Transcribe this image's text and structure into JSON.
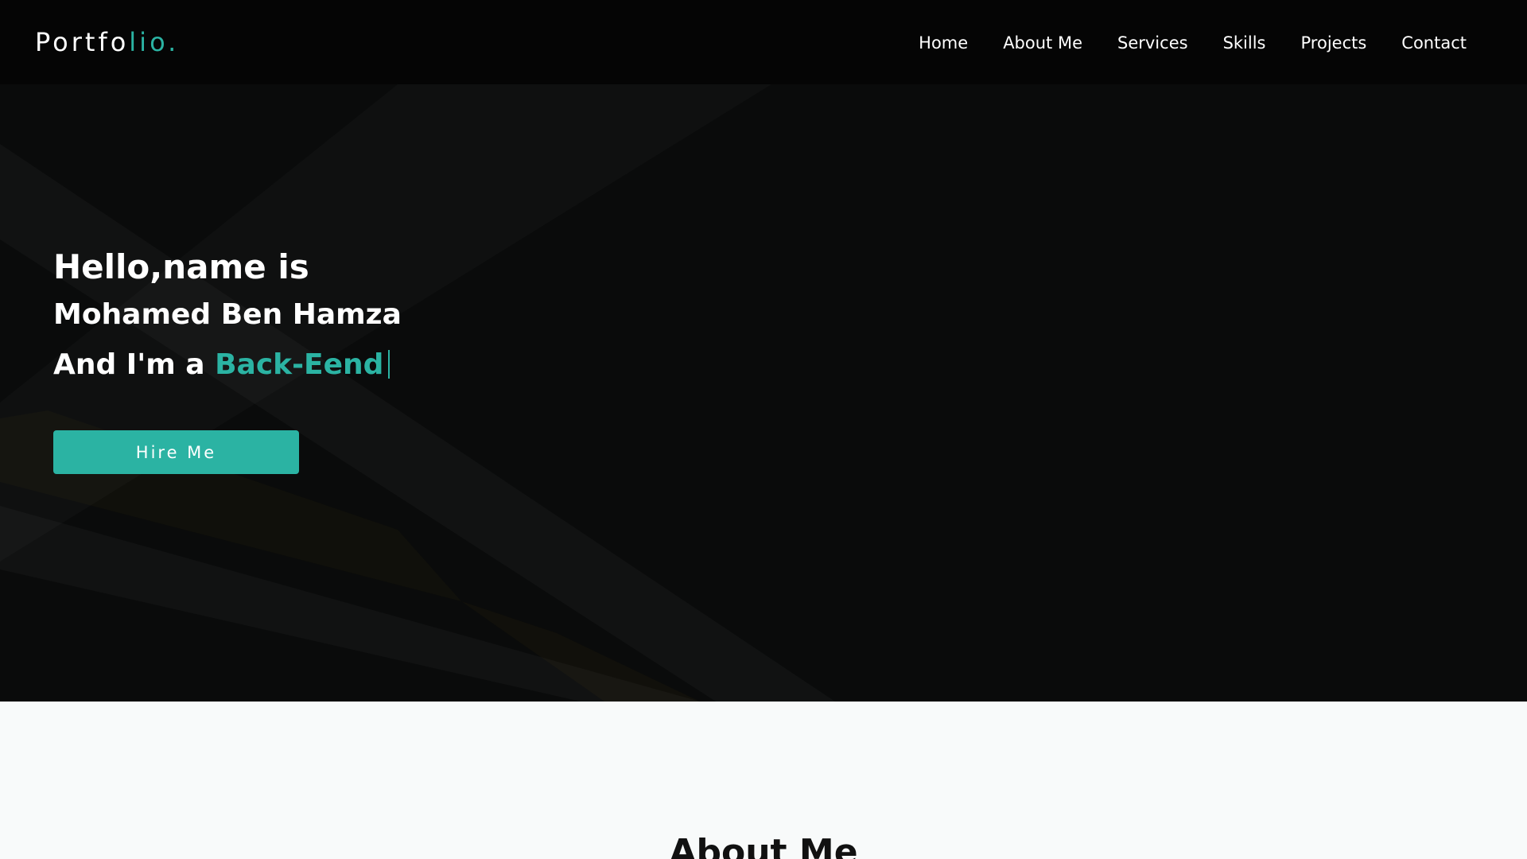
{
  "header": {
    "logo_main": "Portfo",
    "logo_accent": "lio.",
    "nav": [
      "Home",
      "About Me",
      "Services",
      "Skills",
      "Projects",
      "Contact"
    ]
  },
  "hero": {
    "greeting": "Hello,name is",
    "name": "Mohamed Ben Hamza",
    "role_prefix": "And I'm a ",
    "role_typed": "Back-Eend",
    "hire_button": "Hire Me"
  },
  "about": {
    "title": "About Me"
  },
  "colors": {
    "accent": "#2bb3a3",
    "background_dark": "#0a0b0b",
    "navbar": "#050505",
    "section_light": "#f8fafa"
  }
}
